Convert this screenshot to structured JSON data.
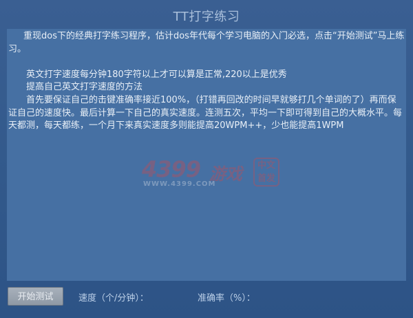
{
  "app": {
    "title": "TT打字练习"
  },
  "content": {
    "paragraphs": [
      "重现dos下的经典打字练习程序，估计dos年代每个学习电脑的入门必选，点击“开始测试”马上练习。",
      "英文打字速度每分钟180字符以上才可以算是正常,220以上是优秀",
      "提高自己英文打字速度的方法",
      "首先要保证自己的击键准确率接近100%，（打错再回改的时间早就够打几个单词的了）再而保证自己的速度快。最后计算一下自己的真实速度。连测五次，平均一下即可得到自己的大概水平。每天都测，每天都练，一个月下来真实速度多则能提高20WPM++，少也能提高1WPM"
    ]
  },
  "watermark": {
    "brand": "4399",
    "game": "游戏",
    "url": "WWW.4399.COM",
    "seal": "中文\n首发"
  },
  "controls": {
    "start_label": "开始测试",
    "speed_label": "速度（个/分钟）：",
    "accuracy_label": "准确率（%）："
  },
  "colors": {
    "background": "#2f5486",
    "panel": "#4670a3",
    "title_text": "#a9bfdb",
    "watermark": "#c84a52"
  }
}
